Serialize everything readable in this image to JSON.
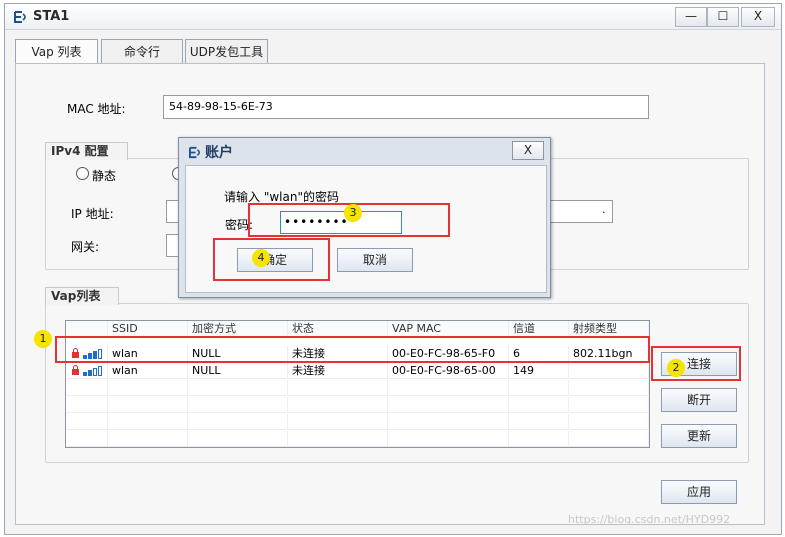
{
  "window": {
    "title": "STA1",
    "min_label": "—",
    "max_label": "☐",
    "close_label": "X"
  },
  "tabs": [
    {
      "label": "Vap 列表"
    },
    {
      "label": "命令行"
    },
    {
      "label": "UDP发包工具"
    }
  ],
  "mac": {
    "label": "MAC 地址:",
    "value": "54-89-98-15-6E-73"
  },
  "ipv4": {
    "group_title": "IPv4 配置",
    "static_label": "静态",
    "ip_label": "IP 地址:",
    "gateway_label": "网关:",
    "ip_dot": "."
  },
  "vap": {
    "group_title": "Vap列表",
    "columns": [
      "",
      "SSID",
      "加密方式",
      "状态",
      "VAP MAC",
      "信道",
      "射频类型"
    ],
    "rows": [
      {
        "ssid": "wlan",
        "encryption": "NULL",
        "status": "未连接",
        "vap_mac": "00-E0-FC-98-65-F0",
        "channel": "6",
        "radio_type": "802.11bgn",
        "signal": 4
      },
      {
        "ssid": "wlan",
        "encryption": "NULL",
        "status": "未连接",
        "vap_mac": "00-E0-FC-98-65-00",
        "channel": "149",
        "radio_type": "",
        "signal": 2
      }
    ]
  },
  "buttons": {
    "connect": "连接",
    "disconnect": "断开",
    "refresh": "更新",
    "apply": "应用"
  },
  "dialog": {
    "title": "账户",
    "close_label": "X",
    "prompt": "请输入 \"wlan\"的密码",
    "password_label": "密码:",
    "password_value": "••••••••",
    "ok": "确定",
    "cancel": "取消"
  },
  "annotations": {
    "b1": "1",
    "b2": "2",
    "b3": "3",
    "b4": "4",
    "highlight_color": "#e53333",
    "badge_color": "#f5e400"
  },
  "watermark": "https://blog.csdn.net/HYD992"
}
